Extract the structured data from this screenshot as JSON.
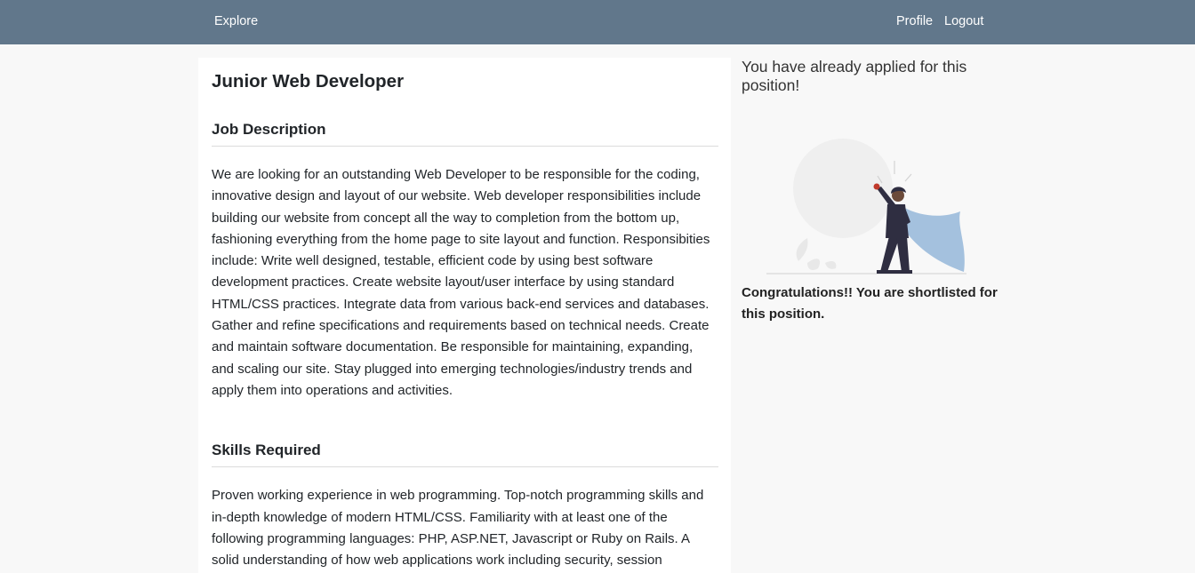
{
  "nav": {
    "explore": "Explore",
    "profile": "Profile",
    "logout": "Logout"
  },
  "job": {
    "title": "Junior Web Developer",
    "description_heading": "Job Description",
    "description": "We are looking for an outstanding Web Developer to be responsible for the coding, innovative design and layout of our website. Web developer responsibilities include building our website from concept all the way to completion from the bottom up, fashioning everything from the home page to site layout and function. Responsibities include: Write well designed, testable, efficient code by using best software development practices. Create website layout/user interface by using standard HTML/CSS practices. Integrate data from various back-end services and databases. Gather and refine specifications and requirements based on technical needs. Create and maintain software documentation. Be responsible for maintaining, expanding, and scaling our site. Stay plugged into emerging technologies/industry trends and apply them into operations and activities.",
    "skills_heading": "Skills Required",
    "skills": "Proven working experience in web programming. Top-notch programming skills and in-depth knowledge of modern HTML/CSS. Familiarity with at least one of the following programming languages: PHP, ASP.NET, Javascript or Ruby on Rails. A solid understanding of how web applications work including security, session"
  },
  "status": {
    "applied_message": "You have already applied for this position!",
    "shortlisted_message": "Congratulations!! You are shortlisted for this position.",
    "illustration_icon": "superhero-woman-illustration",
    "colors": {
      "navbar": "#61778b",
      "cape": "#a4c1de",
      "figure": "#2f2e41"
    }
  }
}
